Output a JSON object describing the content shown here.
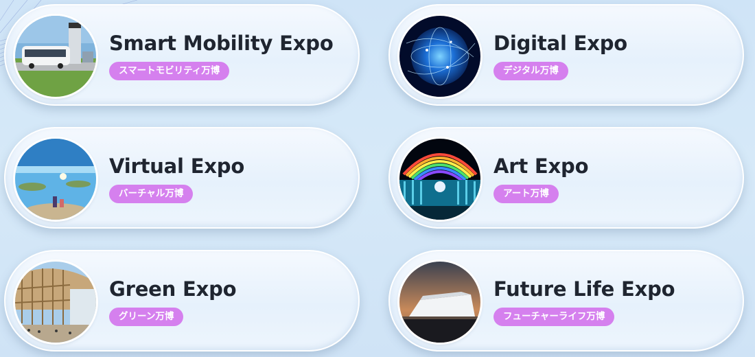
{
  "expos": [
    {
      "title": "Smart Mobility Expo",
      "subtitle": "スマートモビリティ万博",
      "image": "autonomous-bus-image"
    },
    {
      "title": "Digital Expo",
      "subtitle": "デジタル万博",
      "image": "digital-globe-image"
    },
    {
      "title": "Virtual Expo",
      "subtitle": "バーチャル万博",
      "image": "virtual-world-image"
    },
    {
      "title": "Art Expo",
      "subtitle": "アート万博",
      "image": "art-rainbow-moon-image"
    },
    {
      "title": "Green Expo",
      "subtitle": "グリーン万博",
      "image": "wooden-ring-image"
    },
    {
      "title": "Future Life Expo",
      "subtitle": "フューチャーライフ万博",
      "image": "future-pavilion-image"
    }
  ],
  "colors": {
    "badge": "#d580ee",
    "title": "#1f2530",
    "background": "#d3e7f8"
  }
}
